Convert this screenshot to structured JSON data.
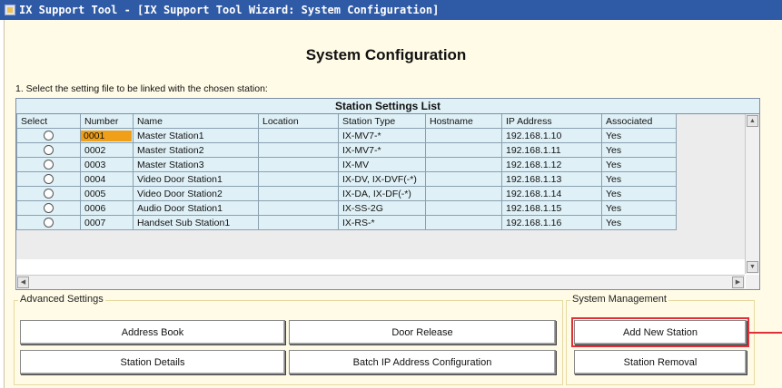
{
  "window": {
    "title": "IX Support Tool - [IX Support Tool Wizard: System Configuration]"
  },
  "page": {
    "title": "System Configuration",
    "instruction": "1. Select the setting file to be linked with the chosen station:"
  },
  "station_list": {
    "title": "Station Settings List",
    "columns": [
      "Select",
      "Number",
      "Name",
      "Location",
      "Station Type",
      "Hostname",
      "IP Address",
      "Associated"
    ],
    "rows": [
      {
        "number": "0001",
        "name": "Master Station1",
        "location": "",
        "station_type": "IX-MV7-*",
        "hostname": "",
        "ip": "192.168.1.10",
        "associated": "Yes"
      },
      {
        "number": "0002",
        "name": "Master Station2",
        "location": "",
        "station_type": "IX-MV7-*",
        "hostname": "",
        "ip": "192.168.1.11",
        "associated": "Yes"
      },
      {
        "number": "0003",
        "name": "Master Station3",
        "location": "",
        "station_type": "IX-MV",
        "hostname": "",
        "ip": "192.168.1.12",
        "associated": "Yes"
      },
      {
        "number": "0004",
        "name": "Video Door Station1",
        "location": "",
        "station_type": "IX-DV, IX-DVF(-*)",
        "hostname": "",
        "ip": "192.168.1.13",
        "associated": "Yes"
      },
      {
        "number": "0005",
        "name": "Video Door Station2",
        "location": "",
        "station_type": "IX-DA, IX-DF(-*)",
        "hostname": "",
        "ip": "192.168.1.14",
        "associated": "Yes"
      },
      {
        "number": "0006",
        "name": "Audio Door Station1",
        "location": "",
        "station_type": "IX-SS-2G",
        "hostname": "",
        "ip": "192.168.1.15",
        "associated": "Yes"
      },
      {
        "number": "0007",
        "name": "Handset Sub Station1",
        "location": "",
        "station_type": "IX-RS-*",
        "hostname": "",
        "ip": "192.168.1.16",
        "associated": "Yes"
      }
    ]
  },
  "advanced": {
    "legend": "Advanced Settings",
    "address_book": "Address Book",
    "door_release": "Door Release",
    "station_details": "Station Details",
    "batch_ip": "Batch IP Address Configuration"
  },
  "management": {
    "legend": "System Management",
    "add_new_station": "Add New Station",
    "station_removal": "Station Removal"
  },
  "colors": {
    "titlebar": "#2f5aa6",
    "window_bg": "#fffbe6",
    "grid_bg": "#dff1f7",
    "selection": "#f0a018",
    "callout": "#e0303a"
  }
}
